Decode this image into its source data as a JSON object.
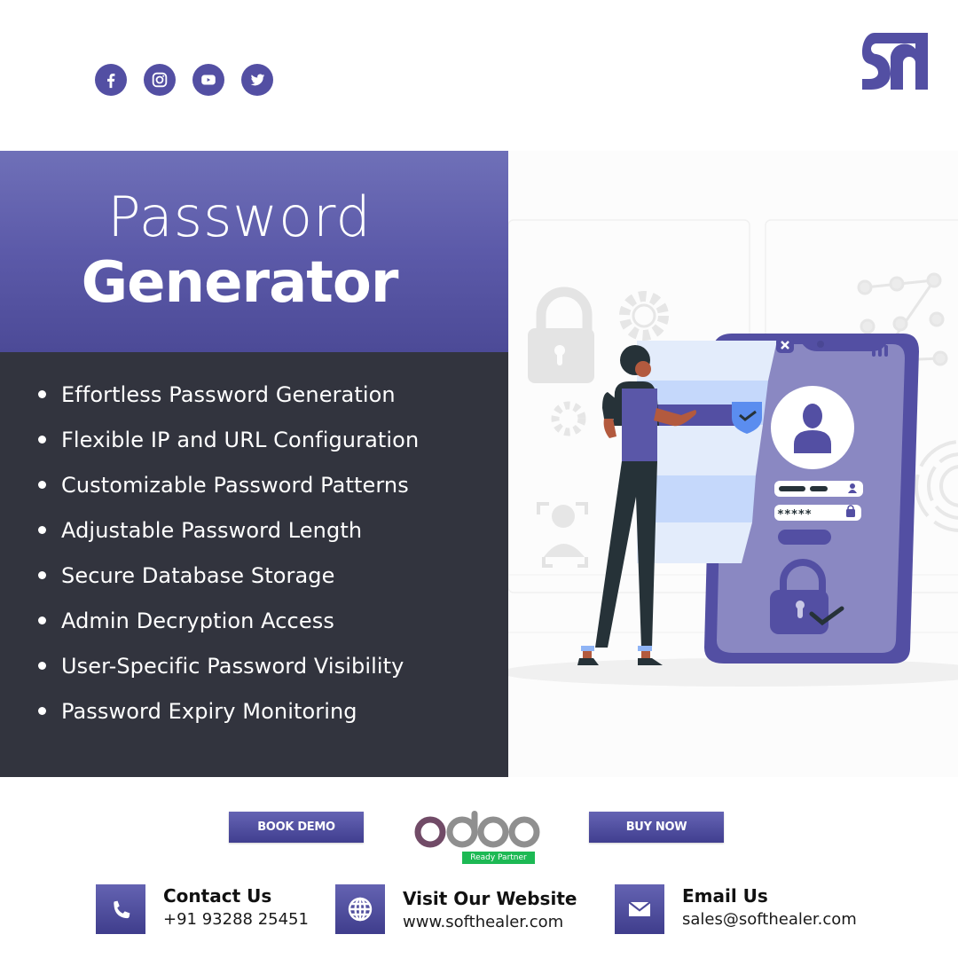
{
  "social": {
    "items": [
      {
        "name": "facebook",
        "icon": "facebook-icon"
      },
      {
        "name": "instagram",
        "icon": "instagram-icon"
      },
      {
        "name": "youtube",
        "icon": "youtube-icon"
      },
      {
        "name": "twitter",
        "icon": "twitter-icon"
      }
    ]
  },
  "brand": {
    "logo": "softhealer-logo",
    "color": "#534fa3"
  },
  "hero": {
    "title_light": "Password",
    "title_bold": "Generator",
    "band_color": "#5c5aa9",
    "panel_color": "#32343e"
  },
  "features": [
    "Effortless Password Generation",
    "Flexible IP and URL Configuration",
    "Customizable Password Patterns",
    "Adjustable Password Length",
    "Secure Database Storage",
    "Admin Decryption Access",
    "User-Specific Password Visibility",
    "Password Expiry Monitoring"
  ],
  "illustration": {
    "description": "person interacting with phone login screen",
    "masked_password": "*****"
  },
  "actions": {
    "book_demo": "BOOK DEMO",
    "buy_now": "BUY NOW"
  },
  "partner": {
    "name": "odoo",
    "badge": "Ready Partner",
    "badge_color": "#1db954"
  },
  "contacts": {
    "phone": {
      "label": "Contact Us",
      "value": "+91 93288 25451",
      "icon": "phone-icon"
    },
    "website": {
      "label": "Visit Our Website",
      "value": "www.softhealer.com",
      "icon": "globe-icon"
    },
    "email": {
      "label": "Email Us",
      "value": "sales@softhealer.com",
      "icon": "envelope-icon"
    }
  }
}
